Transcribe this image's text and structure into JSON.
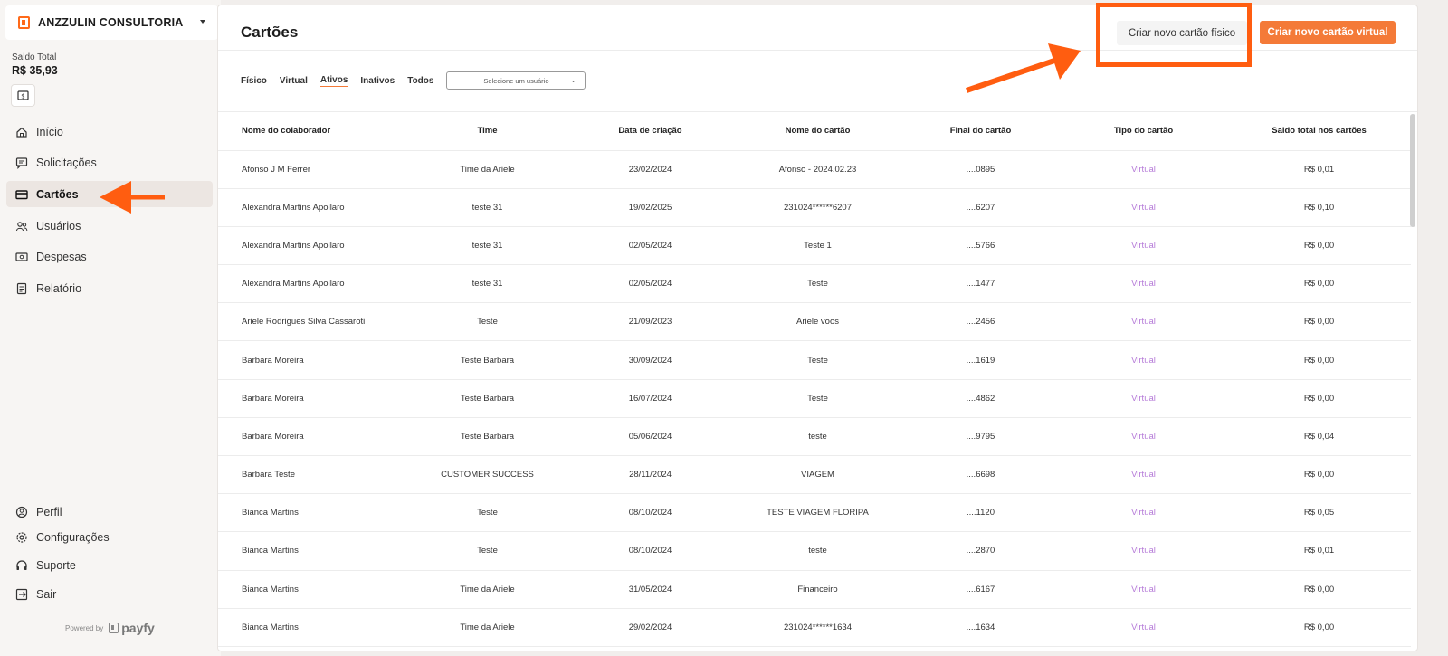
{
  "sidebar": {
    "company_name": "ANZZULIN CONSULTORIA",
    "balance_label": "Saldo Total",
    "balance_value": "R$ 35,93",
    "nav_items": [
      {
        "label": "Início",
        "icon": "home-icon"
      },
      {
        "label": "Solicitações",
        "icon": "message-icon"
      },
      {
        "label": "Cartões",
        "icon": "card-icon",
        "active": true
      },
      {
        "label": "Usuários",
        "icon": "users-icon"
      },
      {
        "label": "Despesas",
        "icon": "money-icon"
      },
      {
        "label": "Relatório",
        "icon": "report-icon"
      }
    ],
    "bottom_items": [
      {
        "label": "Perfil",
        "icon": "profile-icon"
      },
      {
        "label": "Configurações",
        "icon": "gear-icon"
      },
      {
        "label": "Suporte",
        "icon": "headset-icon"
      },
      {
        "label": "Sair",
        "icon": "logout-icon"
      }
    ],
    "powered_by": "Powered by",
    "brand": "payfy"
  },
  "header": {
    "title": "Cartões",
    "btn_physical": "Criar novo cartão físico",
    "btn_virtual": "Criar novo cartão virtual"
  },
  "filters": {
    "tabs": [
      "Físico",
      "Virtual",
      "Ativos",
      "Inativos",
      "Todos"
    ],
    "selected_tab": "Ativos",
    "user_select_placeholder": "Selecione um usuário"
  },
  "table": {
    "columns": [
      "Nome do colaborador",
      "Time",
      "Data de criação",
      "Nome do cartão",
      "Final do cartão",
      "Tipo do cartão",
      "Saldo total nos cartões"
    ],
    "rows": [
      [
        "Afonso J M Ferrer",
        "Time da Ariele",
        "23/02/2024",
        "Afonso - 2024.02.23",
        "....0895",
        "Virtual",
        "R$ 0,01"
      ],
      [
        "Alexandra Martins Apollaro",
        "teste 31",
        "19/02/2025",
        "231024******6207",
        "....6207",
        "Virtual",
        "R$ 0,10"
      ],
      [
        "Alexandra Martins Apollaro",
        "teste 31",
        "02/05/2024",
        "Teste 1",
        "....5766",
        "Virtual",
        "R$ 0,00"
      ],
      [
        "Alexandra Martins Apollaro",
        "teste 31",
        "02/05/2024",
        "Teste",
        "....1477",
        "Virtual",
        "R$ 0,00"
      ],
      [
        "Ariele Rodrigues Silva Cassaroti",
        "Teste",
        "21/09/2023",
        "Ariele voos",
        "....2456",
        "Virtual",
        "R$ 0,00"
      ],
      [
        "Barbara Moreira",
        "Teste Barbara",
        "30/09/2024",
        "Teste",
        "....1619",
        "Virtual",
        "R$ 0,00"
      ],
      [
        "Barbara Moreira",
        "Teste Barbara",
        "16/07/2024",
        "Teste",
        "....4862",
        "Virtual",
        "R$ 0,00"
      ],
      [
        "Barbara Moreira",
        "Teste Barbara",
        "05/06/2024",
        "teste",
        "....9795",
        "Virtual",
        "R$ 0,04"
      ],
      [
        "Barbara Teste",
        "CUSTOMER SUCCESS",
        "28/11/2024",
        "VIAGEM",
        "....6698",
        "Virtual",
        "R$ 0,00"
      ],
      [
        "Bianca Martins",
        "Teste",
        "08/10/2024",
        "TESTE VIAGEM FLORIPA",
        "....1120",
        "Virtual",
        "R$ 0,05"
      ],
      [
        "Bianca Martins",
        "Teste",
        "08/10/2024",
        "teste",
        "....2870",
        "Virtual",
        "R$ 0,01"
      ],
      [
        "Bianca Martins",
        "Time da Ariele",
        "31/05/2024",
        "Financeiro",
        "....6167",
        "Virtual",
        "R$ 0,00"
      ],
      [
        "Bianca Martins",
        "Time da Ariele",
        "29/02/2024",
        "231024******1634",
        "....1634",
        "Virtual",
        "R$ 0,00"
      ]
    ]
  },
  "colors": {
    "accent": "#f47a38",
    "annotation": "#ff5d10",
    "virtual_type": "#b57ad8"
  }
}
